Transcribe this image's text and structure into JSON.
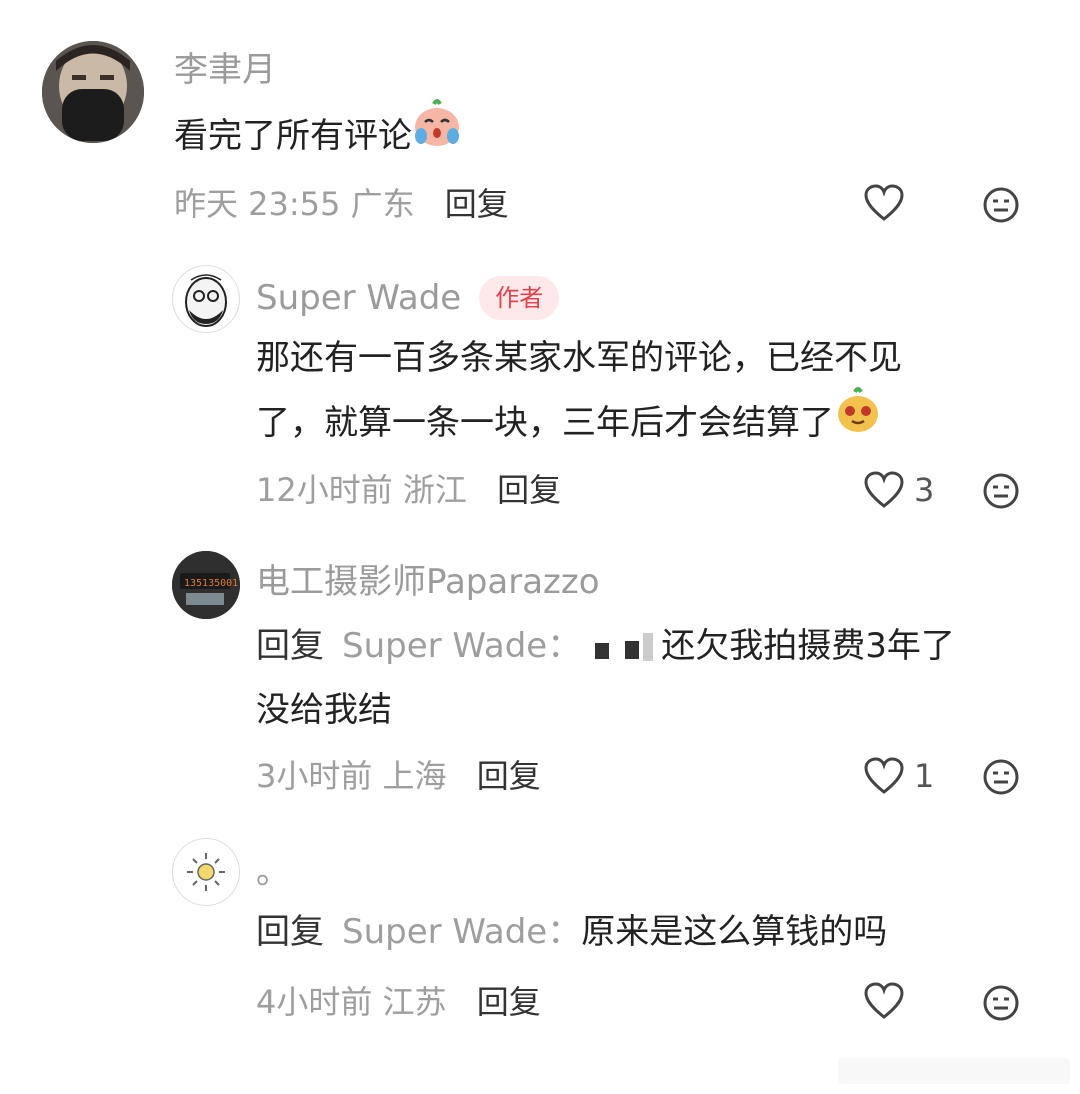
{
  "comments": [
    {
      "user": "李聿月",
      "text": "看完了所有评论",
      "emoji": "crying-face-emoji",
      "time": "昨天 23:55",
      "location": "广东",
      "reply_label": "回复",
      "likes": ""
    },
    {
      "user": "Super Wade",
      "badge": "作者",
      "text_line1": "那还有一百多条某家水军的评论，已经不见",
      "text_line2": "了，就算一条一块，三年后才会结算了",
      "emoji": "smug-face-emoji",
      "time": "12小时前",
      "location": "浙江",
      "reply_label": "回复",
      "likes": "3"
    },
    {
      "user": "电工摄影师Paparazzo",
      "reply_tag": "回复",
      "reply_to": "Super Wade：",
      "text_line1": "还欠我拍摄费3年了",
      "text_line2": "没给我结",
      "time": "3小时前",
      "location": "上海",
      "reply_label": "回复",
      "likes": "1"
    },
    {
      "user": "。",
      "reply_tag": "回复",
      "reply_to": "Super Wade：",
      "text_line1": "原来是这么算钱的吗",
      "time": "4小时前",
      "location": "江苏",
      "reply_label": "回复",
      "likes": ""
    }
  ],
  "colors": {
    "badge_bg": "#fde8ea",
    "badge_text": "#e1434f",
    "muted": "#9e9e9e"
  }
}
